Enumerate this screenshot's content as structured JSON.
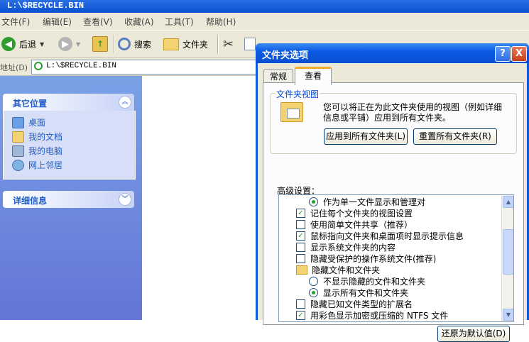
{
  "window": {
    "title": "L:\\$RECYCLE.BIN"
  },
  "menu": [
    "文件(F)",
    "编辑(E)",
    "查看(V)",
    "收藏(A)",
    "工具(T)",
    "帮助(H)"
  ],
  "toolbar": {
    "back": "后退",
    "search": "搜索",
    "folders": "文件夹"
  },
  "address": {
    "label": "地址(D)",
    "value": "L:\\$RECYCLE.BIN"
  },
  "left_pane": {
    "other_places": {
      "title": "其它位置",
      "items": [
        "桌面",
        "我的文档",
        "我的电脑",
        "网上邻居"
      ]
    },
    "details": {
      "title": "详细信息"
    }
  },
  "dialog": {
    "title": "文件夹选项",
    "help_btn": "?",
    "close_btn": "X",
    "tabs": [
      "常规",
      "查看"
    ],
    "folder_views": {
      "label": "文件夹视图",
      "description": "您可以将正在为此文件夹使用的视图（例如详细信息或平铺）应用到所有文件夹。",
      "apply_all": "应用到所有文件夹(L)",
      "reset_all": "重置所有文件夹(R)"
    },
    "advanced_label": "高级设置：",
    "advanced_items": [
      {
        "type": "radio",
        "checked": true,
        "indent": 1,
        "label": "作为单一文件显示和管理对"
      },
      {
        "type": "check",
        "checked": true,
        "indent": 0,
        "label": "记住每个文件夹的视图设置"
      },
      {
        "type": "check",
        "checked": false,
        "indent": 0,
        "label": "使用简单文件共享（推荐）"
      },
      {
        "type": "check",
        "checked": true,
        "indent": 0,
        "label": "鼠标指向文件夹和桌面项时显示提示信息"
      },
      {
        "type": "check",
        "checked": false,
        "indent": 0,
        "label": "显示系统文件夹的内容"
      },
      {
        "type": "check",
        "checked": false,
        "indent": 0,
        "label": "隐藏受保护的操作系统文件(推荐)"
      },
      {
        "type": "folder",
        "checked": false,
        "indent": 0,
        "label": "隐藏文件和文件夹"
      },
      {
        "type": "radio",
        "checked": false,
        "indent": 1,
        "label": "不显示隐藏的文件和文件夹"
      },
      {
        "type": "radio",
        "checked": true,
        "indent": 1,
        "label": "显示所有文件和文件夹"
      },
      {
        "type": "check",
        "checked": false,
        "indent": 0,
        "label": "隐藏已知文件类型的扩展名"
      },
      {
        "type": "check",
        "checked": true,
        "indent": 0,
        "label": "用彩色显示加密或压缩的 NTFS 文件"
      }
    ],
    "restore_defaults": "还原为默认值(D)"
  }
}
